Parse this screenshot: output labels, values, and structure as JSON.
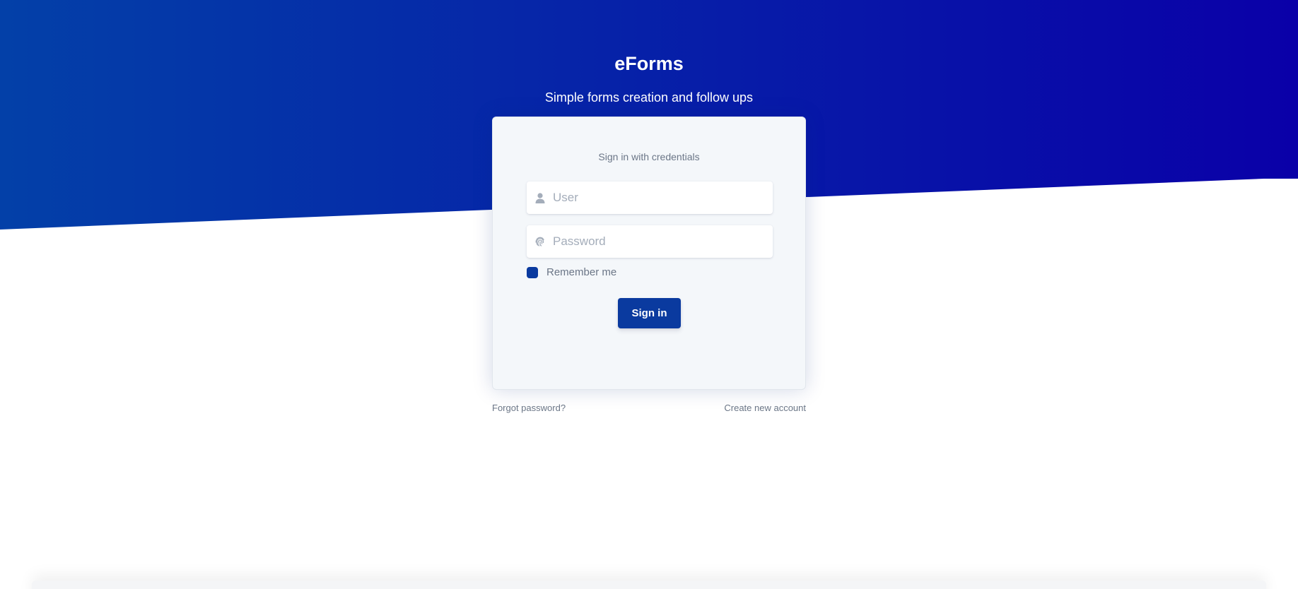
{
  "brand": {
    "title": "eForms",
    "subtitle": "Simple forms creation and follow ups"
  },
  "login": {
    "heading": "Sign in with credentials",
    "user_placeholder": "User",
    "password_placeholder": "Password",
    "remember_label": "Remember me",
    "remember_checked": true,
    "signin_label": "Sign in"
  },
  "links": {
    "forgot_password": "Forgot password?",
    "create_account": "Create new account"
  },
  "icons": {
    "user_field": "user-icon",
    "password_field": "fingerprint-icon"
  },
  "colors": {
    "hero_gradient_start": "#0340a8",
    "hero_gradient_end": "#0a00a8",
    "primary_button": "#0a3a9f",
    "card_background": "#f4f7fa",
    "muted_text": "#6b7687"
  }
}
